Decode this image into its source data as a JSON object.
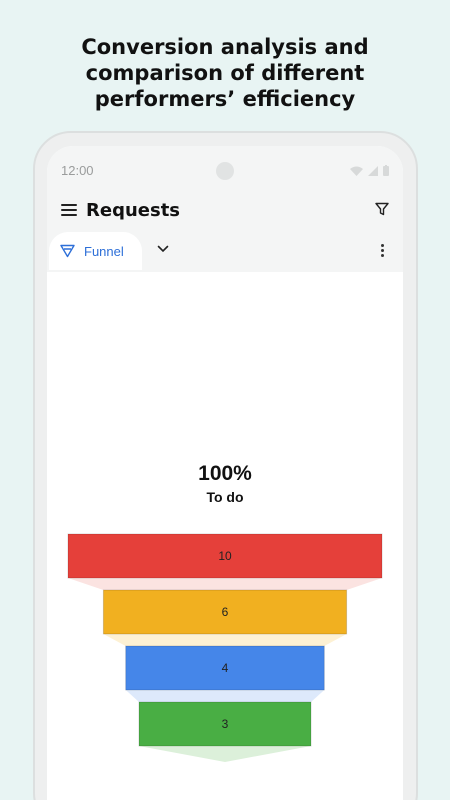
{
  "headline": {
    "line1": "Conversion analysis and",
    "line2": "comparison of different",
    "line3": "performers’ efficiency"
  },
  "status_bar": {
    "time": "12:00"
  },
  "app_bar": {
    "title": "Requests"
  },
  "view_selector": {
    "label": "Funnel"
  },
  "funnel": {
    "top_percent": "100%",
    "top_stage": "To do",
    "colors": {
      "accent": "#2d6fd8"
    }
  },
  "chart_data": {
    "type": "bar",
    "orientation": "funnel",
    "values": [
      10,
      6,
      4,
      3
    ],
    "labels": [
      "10",
      "6",
      "4",
      "3"
    ],
    "colors": [
      "#e5403a",
      "#f1b020",
      "#4586e9",
      "#49ae44"
    ],
    "shadow_colors": [
      "#fbe3e1",
      "#fdf1d4",
      "#dde9fb",
      "#dcf0da"
    ]
  }
}
